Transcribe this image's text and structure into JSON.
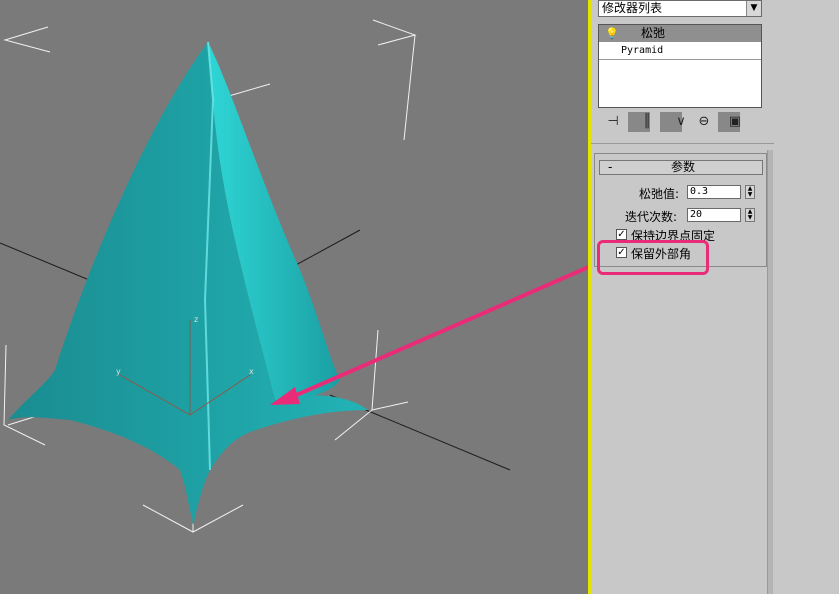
{
  "modifier_list": {
    "label": "修改器列表",
    "arrow_icon": "dropdown-arrow-icon"
  },
  "stack": {
    "items": [
      {
        "label": "松弛",
        "icon": "lightbulb-icon",
        "selected": true
      },
      {
        "label": "Pyramid",
        "selected": false
      }
    ],
    "tools": [
      "pin-stack-icon",
      "show-end-result-icon",
      "make-unique-icon",
      "remove-modifier-icon",
      "configure-modifier-sets-icon"
    ]
  },
  "rollout": {
    "collapse": "-",
    "title": "参数",
    "relax_value_label": "松弛值:",
    "relax_value": "0.3",
    "iterations_label": "迭代次数:",
    "iterations": "20",
    "keep_boundary_label": "保持边界点固定",
    "keep_boundary_checked": true,
    "save_outer_corners_label": "保留外部角",
    "save_outer_corners_checked": true
  },
  "viewport": {
    "object": "Pyramid",
    "object_color": "#1fb8b8",
    "gizmo_axes": [
      "x",
      "y",
      "z"
    ]
  },
  "colors": {
    "highlight": "#ea2c78",
    "viewport_bg": "#7a7a7a",
    "panel_bg": "#c8c8c8",
    "active_border": "#e4e600"
  }
}
